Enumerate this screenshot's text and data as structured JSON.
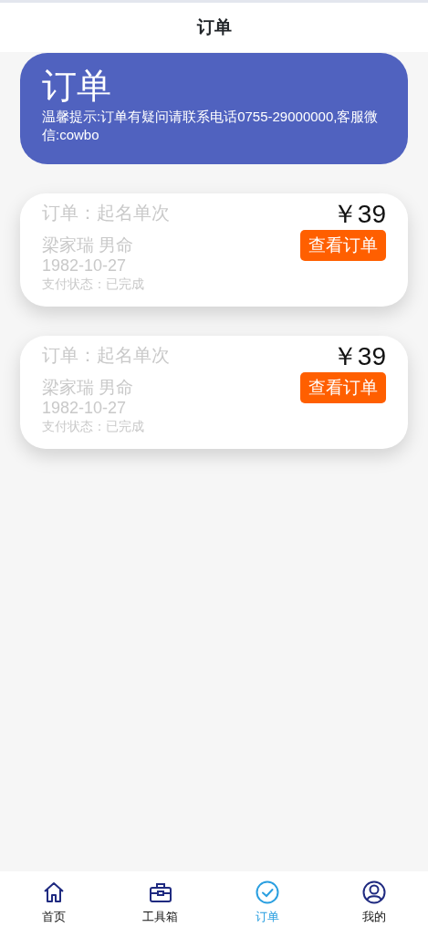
{
  "header": {
    "title": "订单"
  },
  "banner": {
    "title": "订单",
    "notice": "温馨提示:订单有疑问请联系电话0755-29000000,客服微信:cowbo"
  },
  "orders": [
    {
      "title": "订单：起名单次",
      "name": "梁家瑞 男命",
      "date": "1982-10-27",
      "status": "支付状态：已完成",
      "price": "￥39",
      "button": "查看订单"
    },
    {
      "title": "订单：起名单次",
      "name": "梁家瑞 男命",
      "date": "1982-10-27",
      "status": "支付状态：已完成",
      "price": "￥39",
      "button": "查看订单"
    }
  ],
  "tabs": [
    {
      "kind": "home",
      "label": "首页",
      "selected": false
    },
    {
      "kind": "toolbox",
      "label": "工具箱",
      "selected": false
    },
    {
      "kind": "check",
      "label": "订单",
      "selected": true
    },
    {
      "kind": "user",
      "label": "我的",
      "selected": false
    }
  ]
}
